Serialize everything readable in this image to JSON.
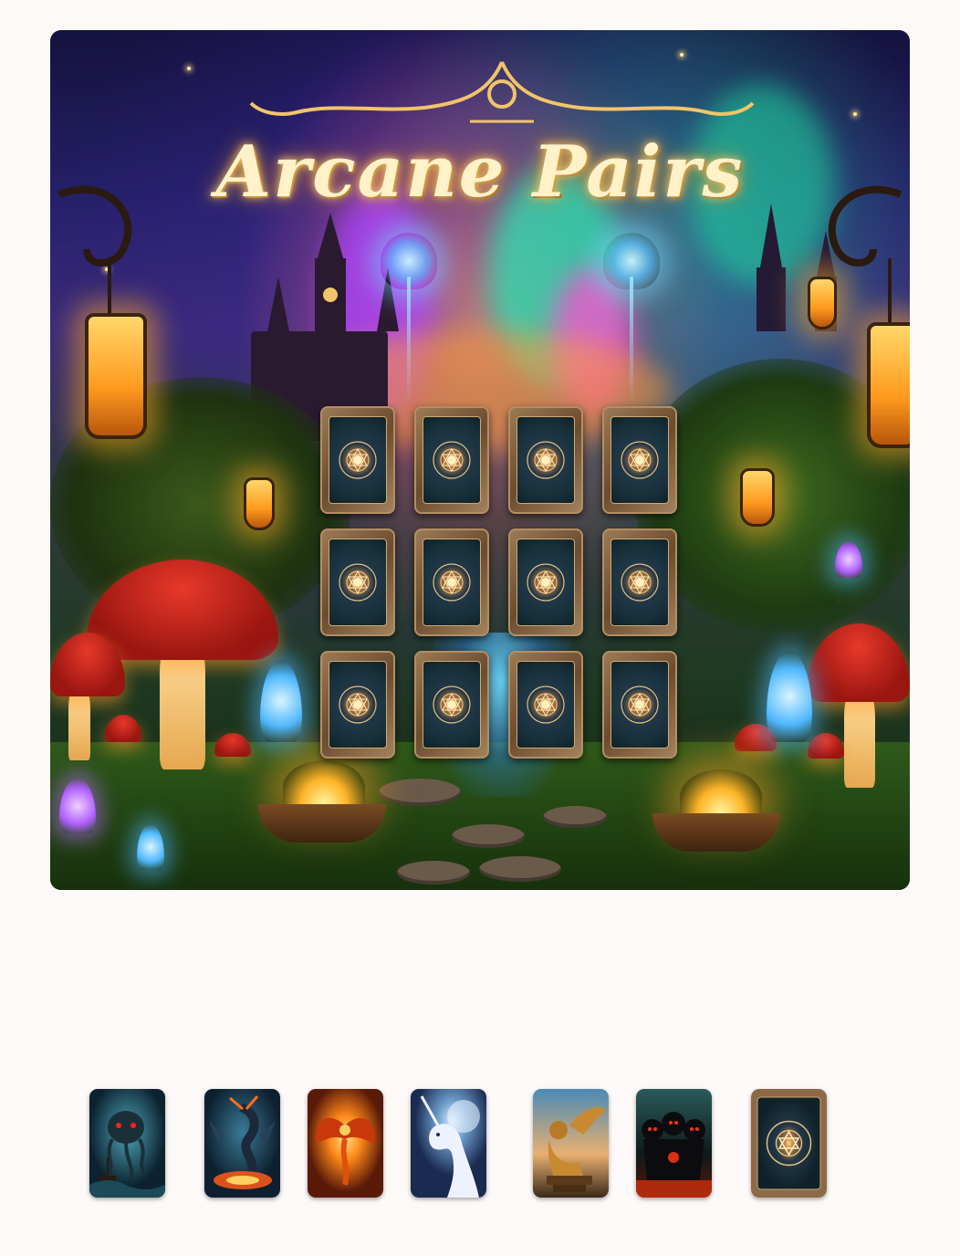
{
  "game": {
    "title": "Arcane Pairs"
  },
  "board": {
    "rows": 3,
    "columns": 4,
    "cards": [
      {
        "state": "face-down"
      },
      {
        "state": "face-down"
      },
      {
        "state": "face-down"
      },
      {
        "state": "face-down"
      },
      {
        "state": "face-down"
      },
      {
        "state": "face-down"
      },
      {
        "state": "face-down"
      },
      {
        "state": "face-down"
      },
      {
        "state": "face-down"
      },
      {
        "state": "face-down"
      },
      {
        "state": "face-down"
      },
      {
        "state": "face-down"
      }
    ]
  },
  "tray": {
    "cards": [
      {
        "icon": "kraken-icon"
      },
      {
        "icon": "dragon-icon"
      },
      {
        "icon": "phoenix-icon"
      },
      {
        "icon": "unicorn-icon"
      },
      {
        "icon": "griffin-icon"
      },
      {
        "icon": "cerberus-icon"
      },
      {
        "icon": "card-back-icon"
      }
    ]
  },
  "colors": {
    "page_background": "#fdf9f8",
    "title_glow": "#ffcf70",
    "card_frame": "#b48e62",
    "card_face": "#17303b"
  }
}
